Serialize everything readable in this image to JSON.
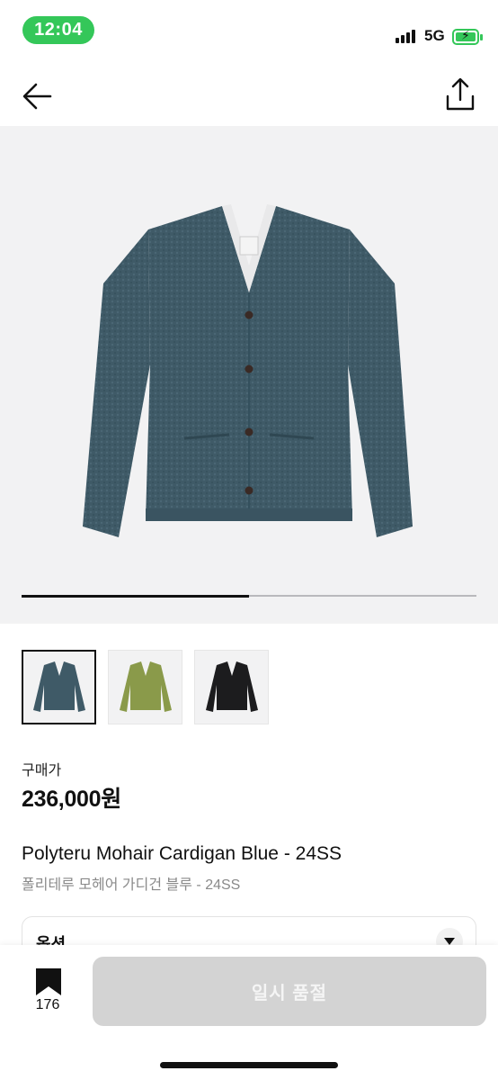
{
  "status_bar": {
    "time": "12:04",
    "network": "5G"
  },
  "product": {
    "price_label": "구매가",
    "price": "236,000원",
    "name_en": "Polyteru Mohair Cardigan Blue - 24SS",
    "name_ko": "폴리테루 모헤어 가디건 블루 - 24SS"
  },
  "gallery": {
    "progress": 0.5,
    "thumbnails": [
      {
        "variant": "Blue",
        "color": "#3f5a67"
      },
      {
        "variant": "Green",
        "color": "#8a9a4a"
      },
      {
        "variant": "Black",
        "color": "#1c1c1e"
      }
    ]
  },
  "option": {
    "label": "옵션"
  },
  "bottom": {
    "bookmark_count": "176",
    "buy_button": "일시 품절"
  },
  "colors": {
    "accent_green": "#34c759",
    "disabled_button": "#d3d3d3",
    "hero_bg": "#f2f2f3"
  },
  "icons": {
    "back": "back-arrow-icon",
    "share": "share-icon",
    "bookmark": "bookmark-icon",
    "option_toggle": "chevron-down-icon"
  }
}
